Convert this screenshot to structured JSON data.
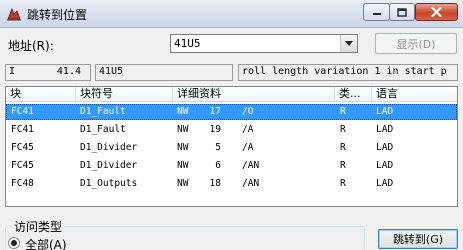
{
  "window": {
    "title": "跳转到位置"
  },
  "address": {
    "label": "地址(R):",
    "value": "41U5",
    "display_button": "显示(D)"
  },
  "info": {
    "field1_prefix": "I",
    "field1_value": "41.4",
    "field2": "41U5",
    "field3": "roll length variation 1 in start p"
  },
  "table": {
    "headers": [
      "块",
      "块符号",
      "详细资料",
      "类...",
      "语言"
    ],
    "rows": [
      {
        "block": "FC41",
        "symbol": "D1_Fault",
        "nw": "NW",
        "num": "17",
        "op": "/O",
        "type": "R",
        "lang": "LAD",
        "selected": true
      },
      {
        "block": "FC41",
        "symbol": "D1_Fault",
        "nw": "NW",
        "num": "19",
        "op": "/A",
        "type": "R",
        "lang": "LAD",
        "selected": false
      },
      {
        "block": "FC45",
        "symbol": "D1_Divider",
        "nw": "NW",
        "num": "5",
        "op": "/A",
        "type": "R",
        "lang": "LAD",
        "selected": false
      },
      {
        "block": "FC45",
        "symbol": "D1_Divider",
        "nw": "NW",
        "num": "6",
        "op": "/AN",
        "type": "R",
        "lang": "LAD",
        "selected": false
      },
      {
        "block": "FC48",
        "symbol": "D1_Outputs",
        "nw": "NW",
        "num": "18",
        "op": "/AN",
        "type": "R",
        "lang": "LAD",
        "selected": false
      }
    ]
  },
  "access_type": {
    "label": "访问类型",
    "option_all": "全部(A)"
  },
  "jump_button": "跳转到(G)"
}
